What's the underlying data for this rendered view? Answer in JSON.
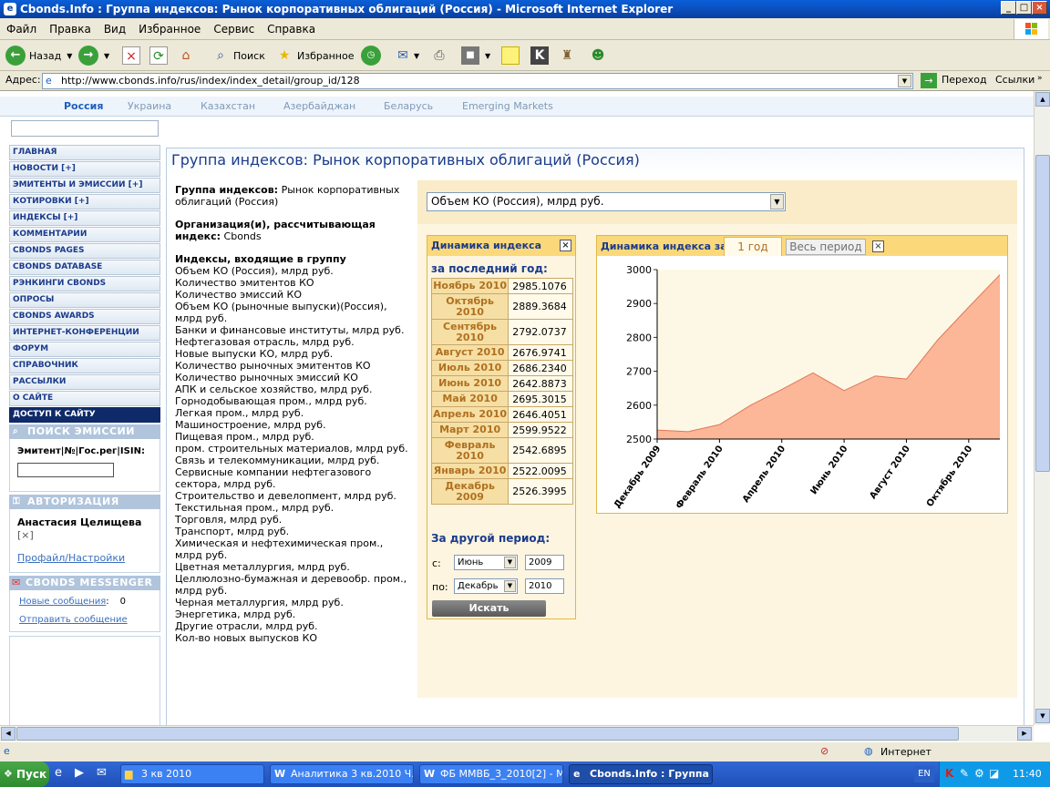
{
  "window": {
    "title": "Cbonds.Info : Группа индексов: Рынок корпоративных облигаций (Россия) - Microsoft Internet Explorer"
  },
  "menu": [
    "Файл",
    "Правка",
    "Вид",
    "Избранное",
    "Сервис",
    "Справка"
  ],
  "toolbar": {
    "back": "Назад",
    "search": "Поиск",
    "favorites": "Избранное"
  },
  "address": {
    "label": "Адрес:",
    "url": "http://www.cbonds.info/rus/index/index_detail/group_id/128",
    "go": "Переход",
    "links": "Ссылки"
  },
  "countries": [
    "Россия",
    "Украина",
    "Казахстан",
    "Азербайджан",
    "Беларусь",
    "Emerging Markets"
  ],
  "nav": [
    "ГЛАВНАЯ",
    "НОВОСТИ [+]",
    "ЭМИТЕНТЫ И ЭМИССИИ [+]",
    "КОТИРОВКИ [+]",
    "ИНДЕКСЫ [+]",
    "КОММЕНТАРИИ",
    "CBONDS PAGES",
    "CBONDS DATABASE",
    "РЭНКИНГИ CBONDS",
    "ОПРОСЫ",
    "CBONDS AWARDS",
    "ИНТЕРНЕТ-КОНФЕРЕНЦИИ",
    "ФОРУМ",
    "СПРАВОЧНИК",
    "РАССЫЛКИ",
    "О САЙТЕ",
    "ДОСТУП К САЙТУ"
  ],
  "sidebar": {
    "search_header": "ПОИСК ЭМИССИИ",
    "search_label": "Эмитент|№|Гос.рег|ISIN:",
    "auth_header": "АВТОРИЗАЦИЯ",
    "user_name": "Анастасия Целищева",
    "logout": "[×]",
    "profile_link": "Профайл/Настройки",
    "messenger_header": "CBONDS MESSENGER",
    "new_messages": "Новые сообщения",
    "new_messages_count": "0",
    "send_message": "Отправить сообщение"
  },
  "main": {
    "title": "Группа индексов: Рынок корпоративных облигаций (Россия)",
    "group_label": "Группа индексов:",
    "group_value": "Рынок корпоративных облигаций (Россия)",
    "org_label": "Организация(и), рассчитывающая индекс:",
    "org_value": "Cbonds",
    "indices_label": "Индексы, входящие в группу",
    "indices": [
      "Объем КО (Россия), млрд руб.",
      "Количество эмитентов КО",
      "Количество эмиссий КО",
      "Объем КО (рыночные выпуски)(Россия), млрд руб.",
      "Банки и финансовые институты, млрд руб.",
      "Нефтегазовая отрасль, млрд руб.",
      "Новые выпуски КО, млрд руб.",
      "Количество рыночных эмитентов КО",
      "Количество рыночных эмиссий КО",
      "АПК и сельское хозяйство, млрд руб.",
      "Горнодобывающая пром., млрд руб.",
      "Легкая пром., млрд руб.",
      "Машиностроение, млрд руб.",
      "Пищевая пром., млрд руб.",
      "пром. строительных материалов, млрд руб.",
      "Связь и телекоммуникации, млрд руб.",
      "Сервисные компании нефтегазового сектора, млрд руб.",
      "Строительство и девелопмент, млрд руб.",
      "Текстильная пром., млрд руб.",
      "Торговля, млрд руб.",
      "Транспорт, млрд руб.",
      "Химическая и нефтехимическая пром., млрд руб.",
      "Цветная металлургия, млрд руб.",
      "Целлюлозно-бумажная и деревообр. пром., млрд руб.",
      "Черная металлургия, млрд руб.",
      "Энергетика, млрд руб.",
      "Другие отрасли, млрд руб.",
      "Кол-во новых выпусков КО"
    ],
    "select_value": "Объем КО (Россия), млрд руб."
  },
  "dyn": {
    "header": "Динамика индекса",
    "last_year": "за последний год:",
    "other_period": "За другой период:",
    "from_label": "с:",
    "to_label": "по:",
    "from_month": "Июнь",
    "from_year": "2009",
    "to_month": "Декабрь",
    "to_year": "2010",
    "search_btn": "Искать",
    "rows": [
      {
        "m": "Ноябрь 2010",
        "v": "2985.1076"
      },
      {
        "m": "Октябрь 2010",
        "v": "2889.3684"
      },
      {
        "m": "Сентябрь 2010",
        "v": "2792.0737"
      },
      {
        "m": "Август 2010",
        "v": "2676.9741"
      },
      {
        "m": "Июль 2010",
        "v": "2686.2340"
      },
      {
        "m": "Июнь 2010",
        "v": "2642.8873"
      },
      {
        "m": "Май 2010",
        "v": "2695.3015"
      },
      {
        "m": "Апрель 2010",
        "v": "2646.4051"
      },
      {
        "m": "Март 2010",
        "v": "2599.9522"
      },
      {
        "m": "Февраль 2010",
        "v": "2542.6895"
      },
      {
        "m": "Январь 2010",
        "v": "2522.0095"
      },
      {
        "m": "Декабрь 2009",
        "v": "2526.3995"
      }
    ]
  },
  "chart_panel": {
    "header": "Динамика индекса за:",
    "tab_year": "1 год",
    "tab_all": "Весь период"
  },
  "chart_data": {
    "type": "area",
    "x": [
      "Декабрь 2009",
      "Январь 2010",
      "Февраль 2010",
      "Март 2010",
      "Апрель 2010",
      "Май 2010",
      "Июнь 2010",
      "Июль 2010",
      "Август 2010",
      "Сентябрь 2010",
      "Октябрь 2010",
      "Ноябрь 2010"
    ],
    "values": [
      2526.3995,
      2522.0095,
      2542.6895,
      2599.9522,
      2646.4051,
      2695.3015,
      2642.8873,
      2686.234,
      2676.9741,
      2792.0737,
      2889.3684,
      2985.1076
    ],
    "x_tick_labels": [
      "Декабрь 2009",
      "Февраль 2010",
      "Апрель 2010",
      "Июнь 2010",
      "Август 2010",
      "Октябрь 2010"
    ],
    "y_ticks": [
      "3000",
      "2900",
      "2800",
      "2700",
      "2600",
      "2500"
    ],
    "ylim": [
      2500,
      3000
    ],
    "fill_color": "#fcb698",
    "line_color": "#e07858",
    "background": "#fdf8e6"
  },
  "status": {
    "zone": "Интернет"
  },
  "taskbar": {
    "start": "Пуск",
    "tasks": [
      "3 кв 2010",
      "Аналитика 3 кв.2010 Ч...",
      "ФБ ММВБ_3_2010[2] - М...",
      "Cbonds.Info : Группа ..."
    ],
    "lang": "EN",
    "time": "11:40"
  }
}
